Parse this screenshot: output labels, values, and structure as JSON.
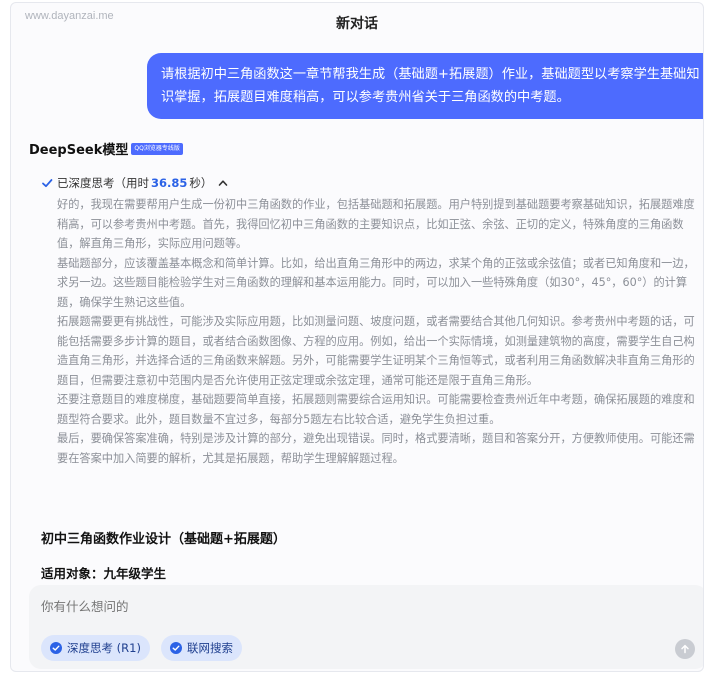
{
  "watermark": "www.dayanzai.me",
  "title": "新对话",
  "user_message": "请根据初中三角函数这一章节帮我生成（基础题+拓展题）作业，基础题型以考察学生基础知识掌握，拓展题目难度稍高，可以参考贵州省关于三角函数的中考题。",
  "model": {
    "name": "DeepSeek模型",
    "badge": "QQ浏览器专线版"
  },
  "thinking": {
    "label_prefix": "已深度思考（用时",
    "seconds": "36.85",
    "label_suffix": "秒）",
    "paragraphs": [
      "好的，我现在需要帮用户生成一份初中三角函数的作业，包括基础题和拓展题。用户特别提到基础题要考察基础知识，拓展题难度稍高，可以参考贵州中考题。首先，我得回忆初中三角函数的主要知识点，比如正弦、余弦、正切的定义，特殊角度的三角函数值，解直角三角形，实际应用问题等。",
      "基础题部分，应该覆盖基本概念和简单计算。比如，给出直角三角形中的两边，求某个角的正弦或余弦值；或者已知角度和一边，求另一边。这些题目能检验学生对三角函数的理解和基本运用能力。同时，可以加入一些特殊角度（如30°，45°，60°）的计算题，确保学生熟记这些值。",
      "拓展题需要更有挑战性，可能涉及实际应用题，比如测量问题、坡度问题，或者需要结合其他几何知识。参考贵州中考题的话，可能包括需要多步计算的题目，或者结合函数图像、方程的应用。例如，给出一个实际情境，如测量建筑物的高度，需要学生自己构造直角三角形，并选择合适的三角函数来解题。另外，可能需要学生证明某个三角恒等式，或者利用三角函数解决非直角三角形的题目，但需要注意初中范围内是否允许使用正弦定理或余弦定理，通常可能还是限于直角三角形。",
      "还要注意题目的难度梯度，基础题要简单直接，拓展题则需要综合运用知识。可能需要检查贵州近年中考题，确保拓展题的难度和题型符合要求。此外，题目数量不宜过多，每部分5题左右比较合适，避免学生负担过重。",
      "最后，要确保答案准确，特别是涉及计算的部分，避免出现错误。同时，格式要清晰，题目和答案分开，方便教师使用。可能还需要在答案中加入简要的解析，尤其是拓展题，帮助学生理解解题过程。"
    ]
  },
  "answer": {
    "title": "初中三角函数作业设计（基础题+拓展题）",
    "subtitle": "适用对象：九年级学生"
  },
  "composer": {
    "placeholder": "你有什么想问的",
    "deep_think_label": "深度思考 (R1)",
    "web_search_label": "联网搜索"
  }
}
